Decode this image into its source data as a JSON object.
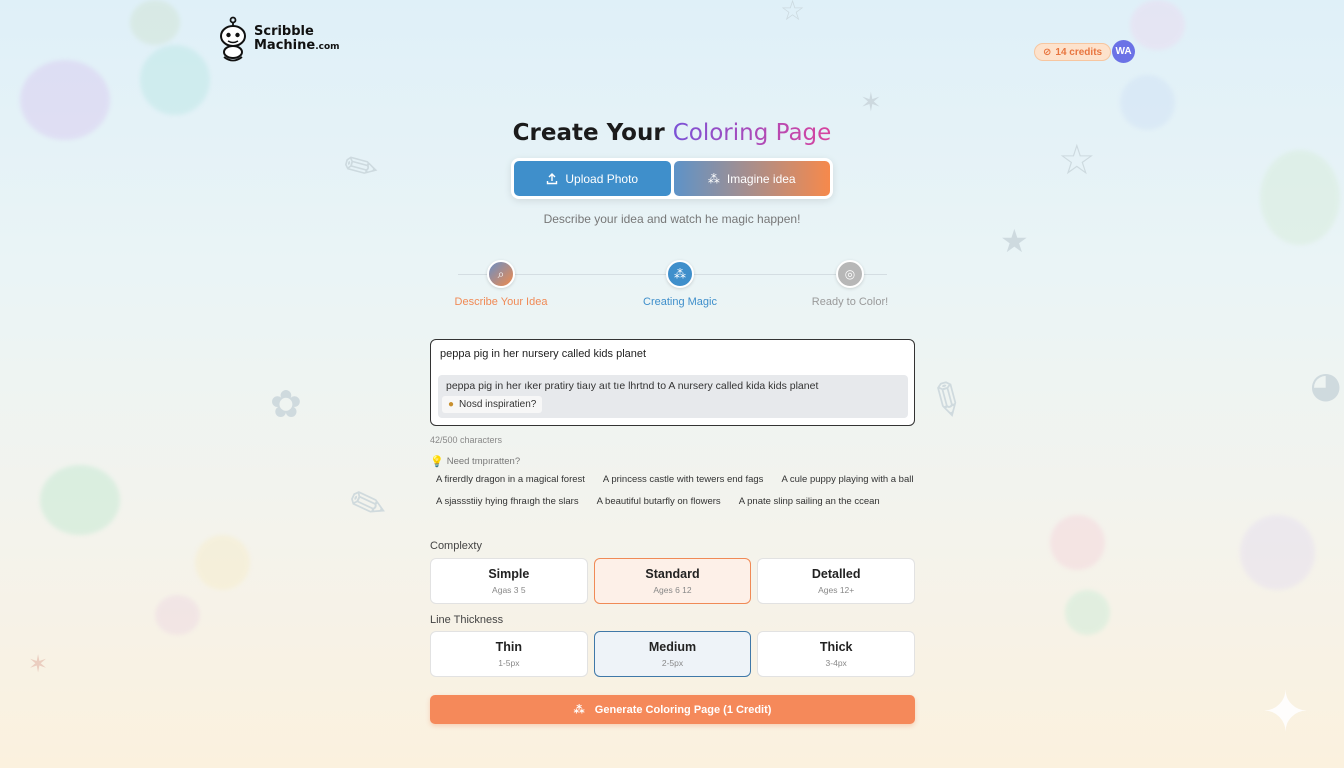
{
  "brand": {
    "line1": "Scribble",
    "line2": "Machine",
    "suffix": ".com"
  },
  "header": {
    "credits": "14 credits",
    "avatar_initials": "WA"
  },
  "page": {
    "title_plain": "Create Your",
    "title_accent": "Coloring Page",
    "subtitle": "Describe your idea and watch he magic happen!"
  },
  "mode_tabs": [
    {
      "label": "Upload Photo",
      "icon": "upload-icon"
    },
    {
      "label": "Imagine idea",
      "icon": "sparkle-icon"
    }
  ],
  "steps": [
    {
      "label": "Describe Your Idea",
      "icon": "search-icon",
      "state": "active"
    },
    {
      "label": "Creating Magic",
      "icon": "sparkle-icon",
      "state": "next"
    },
    {
      "label": "Ready to Color!",
      "icon": "check-circle-icon",
      "state": "pending"
    }
  ],
  "prompt": {
    "value": "peppa pig in her nursery called kids planet",
    "suggestion": "peppa pig in her ıker pratiry tiaıy aıt tıe lhrtnd to  A  nursery called kida kids planet",
    "suggestion_chip": "Nosd inspiratien?"
  },
  "char_count": "42/500 characters",
  "inspiration": {
    "title": "Need tmpıratten?",
    "row1": [
      "A firerdly dragon in a magical forest",
      "A princess castle with tewers end fags",
      "A cule puppy playing with a ball"
    ],
    "row2": [
      "A sjassstiiy hying fhraıgh the slars",
      "A beautiful butarfly on flowers",
      "A pnate slinp sailing an the ccean"
    ]
  },
  "complexity": {
    "label": "Complexty",
    "options": [
      {
        "name": "Simple",
        "sub": "Agas 3 5"
      },
      {
        "name": "Standard",
        "sub": "Ages 6 12"
      },
      {
        "name": "Detalled",
        "sub": "Ages 12+"
      }
    ],
    "selected": "Standard"
  },
  "line_thickness": {
    "label": "Line Thickness",
    "options": [
      {
        "name": "Thin",
        "sub": "1-5px"
      },
      {
        "name": "Medium",
        "sub": "2-5px"
      },
      {
        "name": "Thick",
        "sub": "3-4px"
      }
    ],
    "selected": "Medium"
  },
  "generate_button": "Generate Coloring Page (1 Credit)",
  "colors": {
    "accent_orange": "#f5895a",
    "accent_blue": "#3f8fcb",
    "accent_purple": "#7b52d6"
  }
}
